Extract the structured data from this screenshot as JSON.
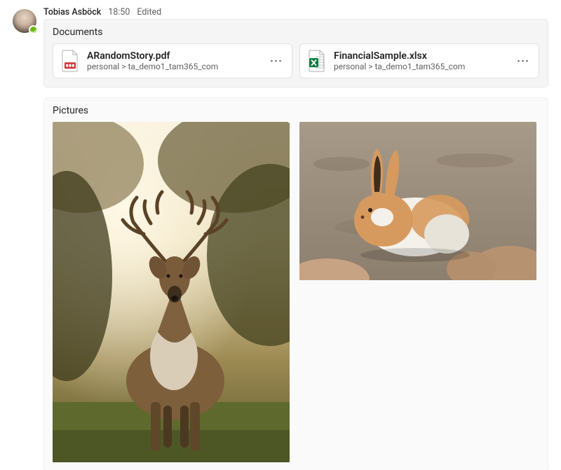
{
  "message": {
    "author": "Tobias Asböck",
    "time": "18:50",
    "edited_label": "Edited"
  },
  "documents": {
    "title": "Documents",
    "items": [
      {
        "name": "ARandomStory.pdf",
        "path": "personal > ta_demo1_tam365_com",
        "icon": "pdf"
      },
      {
        "name": "FinancialSample.xlsx",
        "path": "personal > ta_demo1_tam365_com",
        "icon": "excel"
      }
    ]
  },
  "pictures": {
    "title": "Pictures",
    "items": [
      {
        "alt": "deer"
      },
      {
        "alt": "rabbit"
      }
    ]
  },
  "colors": {
    "pdf_red": "#d13438",
    "excel_green": "#107c41"
  }
}
